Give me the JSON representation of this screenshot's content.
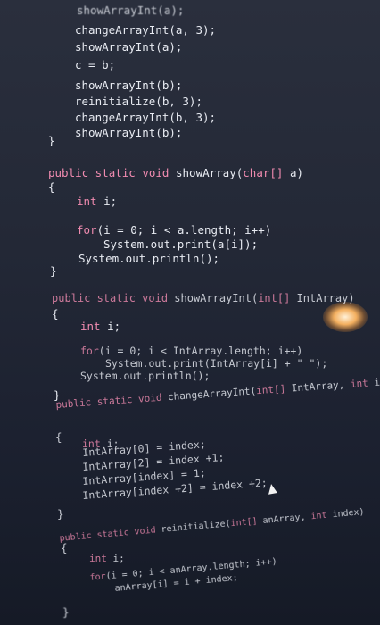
{
  "code": {
    "top_calls": [
      "showArrayInt(a);",
      "changeArrayInt(a, 3);",
      "showArrayInt(a);",
      "c = b;",
      "showArrayInt(b);",
      "reinitialize(b, 3);",
      "changeArrayInt(b, 3);",
      "showArrayInt(b);"
    ],
    "close1": "}",
    "show_array": {
      "signature_kw": "public static void",
      "signature_name": " showArray(",
      "signature_type": "char[]",
      "signature_rest": " a)",
      "open": "{",
      "decl_kw": "int",
      "decl_rest": " i;",
      "for_kw": "for",
      "for_rest": "(i = 0; i < a.length; i++)",
      "print": "System.out.print(a[i]);",
      "println": "System.out.println();",
      "close": "}"
    },
    "show_array_int": {
      "signature_kw": "public static void",
      "signature_name": " showArrayInt(",
      "signature_type": "int[]",
      "signature_rest": " IntArray)",
      "open": "{",
      "decl_kw": "int",
      "decl_rest": " i;",
      "for_kw": "for",
      "for_rest": "(i = 0; i < IntArray.length; i++)",
      "print": "System.out.print(IntArray[i] + \" \");",
      "println": "System.out.println();",
      "close": "}"
    },
    "change_array_int": {
      "signature_kw": "public static void",
      "signature_name": " changeArrayInt(",
      "signature_type": "int[]",
      "signature_rest": " IntArray,",
      "signature_type2": " int",
      "signature_rest2": " index)",
      "open": "{",
      "decl_kw": "int",
      "decl_rest": " i;",
      "line1": "IntArray[0] = index;",
      "line2": "IntArray[2] = index +1;",
      "line3": "IntArray[index] = 1;",
      "line4": "IntArray[index +2] = index +2;",
      "close": "}"
    },
    "reinitialize": {
      "signature_kw": "public static void",
      "signature_name": " reinitialize(",
      "signature_type": "int[]",
      "signature_rest": " anArray,",
      "signature_type2": " int",
      "signature_rest2": " index)",
      "open": "{",
      "decl_kw": "int",
      "decl_rest": " i;",
      "for_kw": "for",
      "for_rest": "(i = 0; i < anArray.length; i++)",
      "assign": "anArray[i] = i + index;",
      "close": "}"
    }
  },
  "colors": {
    "background": "#232836",
    "keyword": "#f08bb0",
    "text": "#e8ebf2"
  }
}
